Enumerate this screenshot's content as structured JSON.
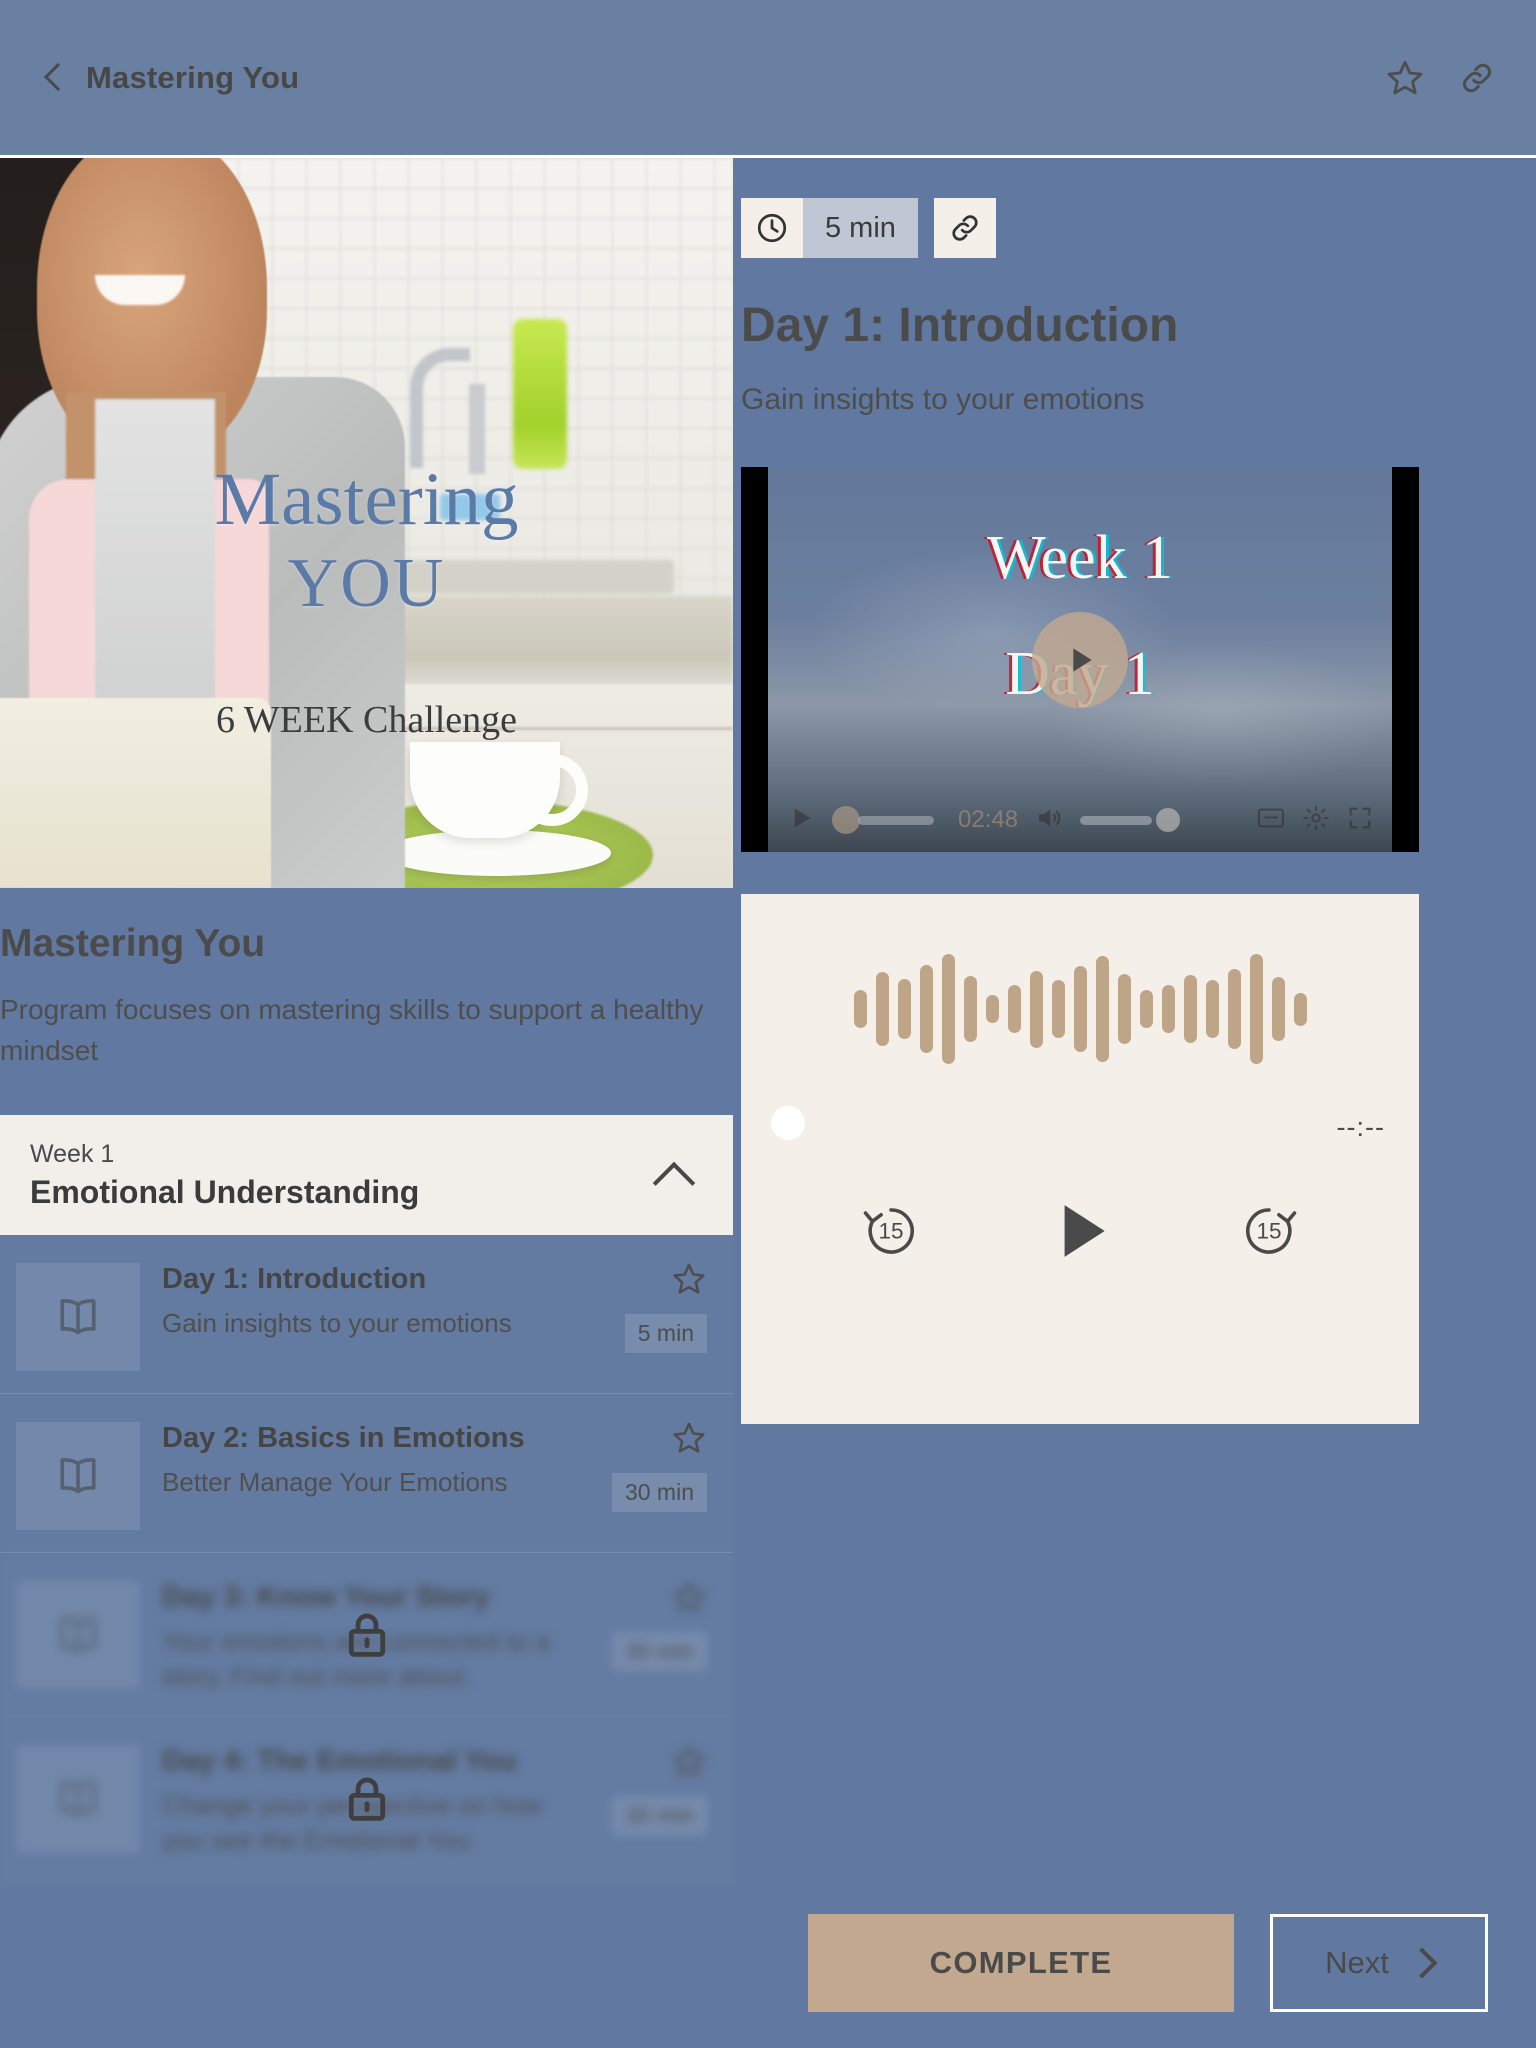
{
  "topbar": {
    "title": "Mastering You",
    "back_icon": "chevron-left-icon",
    "favorite_icon": "star-outline-icon",
    "link_icon": "link-icon"
  },
  "hero": {
    "title_line1": "Mastering",
    "title_line2": "YOU",
    "subtitle": "6 WEEK Challenge"
  },
  "course": {
    "title": "Mastering You",
    "description": "Program focuses on mastering skills to support a healthy mindset"
  },
  "week": {
    "eyebrow": "Week 1",
    "name": "Emotional Understanding",
    "collapse_icon": "chevron-up-icon"
  },
  "lessons": [
    {
      "title": "Day 1: Introduction",
      "subtitle": "Gain insights to your emotions",
      "duration": "5 min",
      "icon": "book-icon",
      "star_icon": "star-outline-icon",
      "locked": false
    },
    {
      "title": "Day 2: Basics in Emotions",
      "subtitle": "Better Manage Your Emotions",
      "duration": "30 min",
      "icon": "book-icon",
      "star_icon": "star-outline-icon",
      "locked": false
    },
    {
      "title": "Day 3: Know Your Story",
      "subtitle": "Your emotions are connected to a story. Find out more about.",
      "duration": "30 min",
      "icon": "book-icon",
      "star_icon": "star-outline-icon",
      "locked": true
    },
    {
      "title": "Day 4: The Emotional You",
      "subtitle": "Change your perspective on how you see the Emotional You",
      "duration": "30 min",
      "icon": "book-icon",
      "star_icon": "star-outline-icon",
      "locked": true
    }
  ],
  "detail": {
    "duration_label": "5 min",
    "clock_icon": "clock-icon",
    "link_icon": "link-icon",
    "heading": "Day 1: Introduction",
    "subheading": "Gain insights to your emotions"
  },
  "video": {
    "overlay_line1": "Week 1",
    "overlay_line2": "Day 1",
    "play_icon": "play-icon",
    "controls": {
      "play_icon": "play-icon",
      "time": "02:48",
      "volume_icon": "volume-icon",
      "captions_icon": "captions-icon",
      "settings_icon": "gear-icon",
      "fullscreen_icon": "fullscreen-icon"
    }
  },
  "audio": {
    "time": "--:--",
    "rewind_label": "15",
    "forward_label": "15",
    "rewind_icon": "replay-15-icon",
    "play_icon": "play-icon",
    "forward_icon": "forward-15-icon",
    "waveform": [
      34,
      68,
      54,
      80,
      100,
      60,
      26,
      44,
      70,
      52,
      78,
      96,
      64,
      34,
      44,
      62,
      52,
      72,
      100,
      58,
      30
    ]
  },
  "footer": {
    "complete_label": "COMPLETE",
    "next_label": "Next",
    "next_icon": "chevron-right-icon"
  },
  "colors": {
    "page_bg": "#6179a0",
    "topbar_bg": "#6a80a2",
    "cream": "#f4efe9",
    "accent_tan": "#c3a890",
    "chip_blue": "#bfc7d4"
  }
}
